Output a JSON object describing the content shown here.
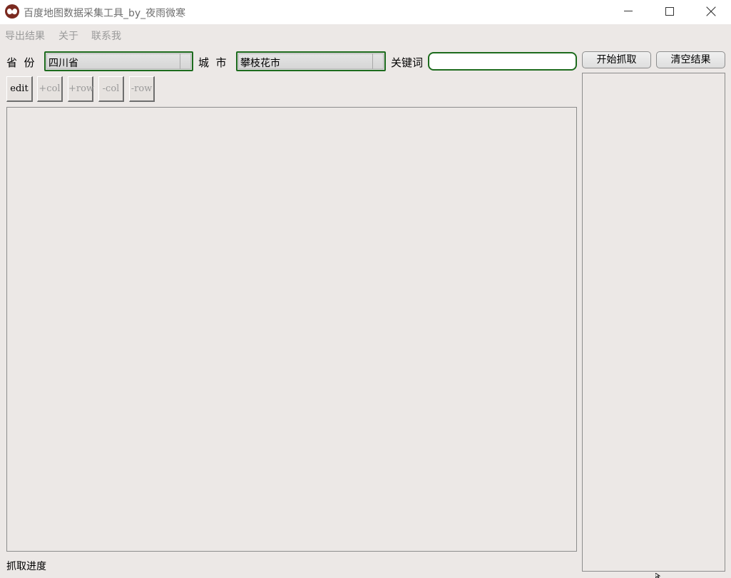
{
  "window": {
    "title": "百度地图数据采集工具_by_夜雨微寒",
    "app_icon": "spiderman-mask-icon",
    "controls": [
      "minimize-icon",
      "maximize-icon",
      "close-icon"
    ]
  },
  "menu": {
    "items": [
      "导出结果",
      "关于",
      "联系我"
    ]
  },
  "filters": {
    "province_label": "省  份",
    "province_value": "四川省",
    "city_label": "城  市",
    "city_value": "攀枝花市",
    "keyword_label": "关键词",
    "keyword_value": ""
  },
  "actions": {
    "start_label": "开始抓取",
    "clear_label": "清空结果"
  },
  "table_toolbar": {
    "edit": "edit",
    "add_col": "+col",
    "add_row": "+row",
    "del_col": "-col",
    "del_row": "-row"
  },
  "status": {
    "progress_label": "抓取进度"
  },
  "colors": {
    "window_bg": "#ece8e6",
    "accent_border": "#1d6b1d",
    "disabled_text": "#9a9a9a"
  }
}
